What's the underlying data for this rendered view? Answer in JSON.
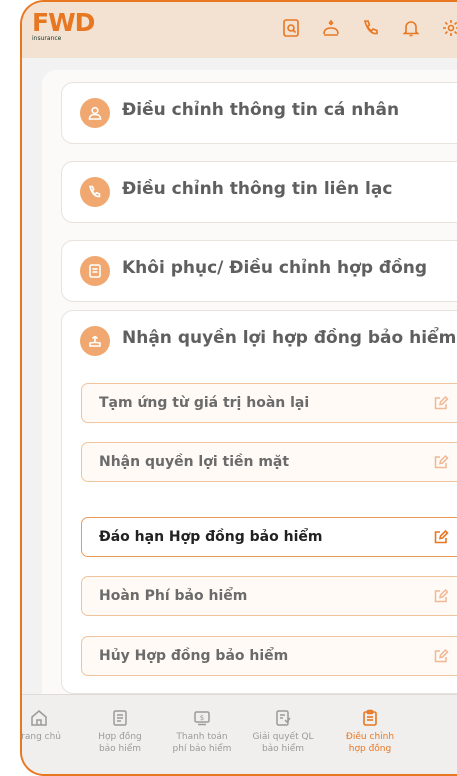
{
  "brand": {
    "logo": "FWD",
    "tagline": "insurance",
    "accent": "#e87722"
  },
  "top_icons": [
    "document-search-icon",
    "user-heart-icon",
    "phone-icon",
    "bell-icon",
    "gear-icon"
  ],
  "sections": [
    {
      "title": "Điều chỉnh thông tin cá nhân",
      "icon": "user-icon",
      "expanded": false
    },
    {
      "title": "Điều chỉnh thông tin liên lạc",
      "icon": "phone-icon",
      "expanded": false
    },
    {
      "title": "Khôi phục/ Điều chỉnh hợp đồng",
      "icon": "document-icon",
      "expanded": false
    },
    {
      "title": "Nhận quyền lợi hợp đồng bảo hiểm",
      "icon": "benefit-icon",
      "expanded": true,
      "items": [
        {
          "label": "Tạm ứng từ giá trị hoàn lại",
          "active": false
        },
        {
          "label": "Nhận quyền lợi tiền mặt",
          "active": false
        },
        {
          "label": "Đáo hạn Hợp đồng bảo hiểm",
          "active": true
        },
        {
          "label": "Hoàn Phí bảo hiểm",
          "active": false
        },
        {
          "label": "Hủy Hợp đồng bảo hiểm",
          "active": false
        }
      ]
    }
  ],
  "bottom_nav": [
    {
      "line1": "Trang chủ",
      "line2": "",
      "icon": "home-icon",
      "active": false
    },
    {
      "line1": "Hợp đồng",
      "line2": "bảo hiểm",
      "icon": "contract-icon",
      "active": false
    },
    {
      "line1": "Thanh toán",
      "line2": "phí bảo hiểm",
      "icon": "payment-icon",
      "active": false
    },
    {
      "line1": "Giải quyết QL",
      "line2": "bảo hiểm",
      "icon": "claim-icon",
      "active": false
    },
    {
      "line1": "Điều chỉnh",
      "line2": "hợp đồng",
      "icon": "adjust-contract-icon",
      "active": true
    }
  ]
}
